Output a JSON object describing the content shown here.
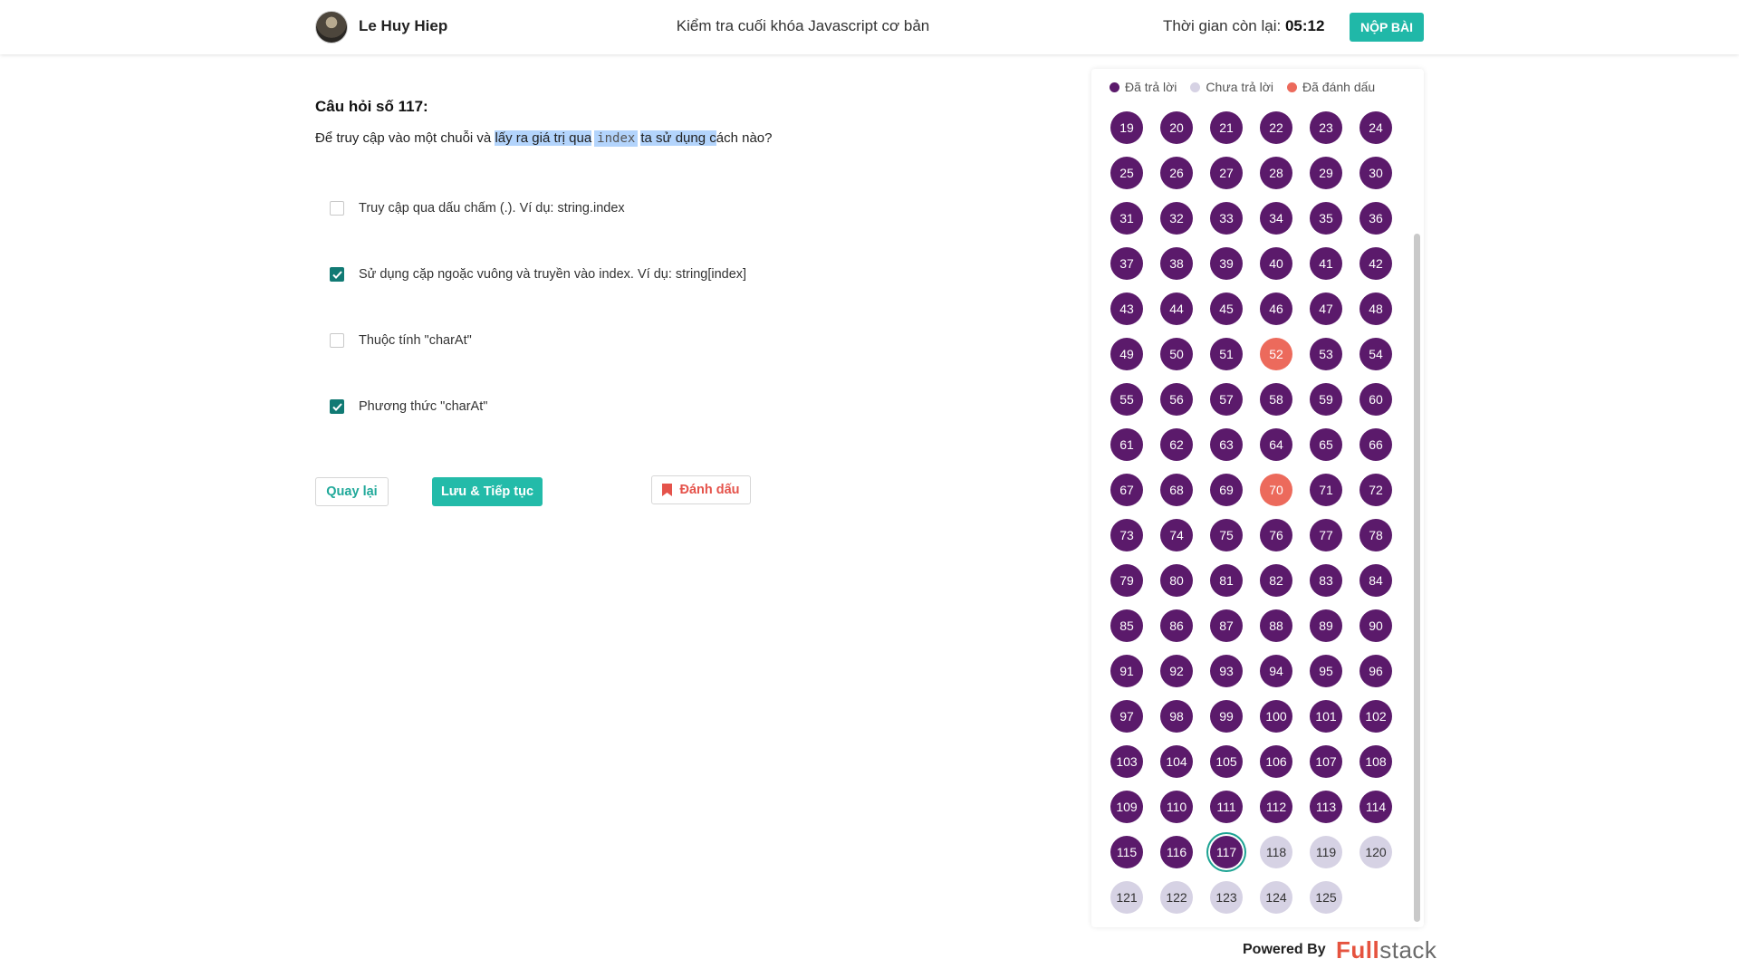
{
  "header": {
    "user_name": "Le Huy Hiep",
    "exam_title": "Kiểm tra cuối khóa Javascript cơ bản",
    "timer_label": "Thời gian còn lại:",
    "timer_value": "05:12",
    "submit_label": "NỘP BÀI"
  },
  "question": {
    "title": "Câu hỏi số 117:",
    "text_before": "Để truy cập vào một chuỗi và ",
    "text_hl1": "lấy ra giá trị qua",
    "code": "index",
    "text_hl2": "ta sử dụng c",
    "text_after": "ách nào?",
    "options": [
      {
        "label": "Truy cập qua dấu chấm (.). Ví dụ: string.index",
        "checked": false
      },
      {
        "label": "Sử dụng cặp ngoặc vuông và truyền vào index. Ví dụ: string[index]",
        "checked": true
      },
      {
        "label": "Thuộc tính \"charAt\"",
        "checked": false
      },
      {
        "label": "Phương thức \"charAt\"",
        "checked": true
      }
    ]
  },
  "actions": {
    "back_label": "Quay lại",
    "next_label": "Lưu & Tiếp tục",
    "mark_label": "Đánh dấu"
  },
  "panel": {
    "legend": {
      "answered": "Đã trả lời",
      "unanswered": "Chưa trả lời",
      "marked": "Đã đánh dấu"
    },
    "colors": {
      "answered": "#5b1a6b",
      "unanswered": "#d6d2e4",
      "marked": "#ec6a5c",
      "current_ring": "#1da393"
    },
    "first_visible": 19,
    "last": 125,
    "marked": [
      52,
      70
    ],
    "current": 117,
    "last_answered": 117
  },
  "footer": {
    "powered_by": "Powered By",
    "logo_full": "Full",
    "logo_stack": "stack"
  }
}
